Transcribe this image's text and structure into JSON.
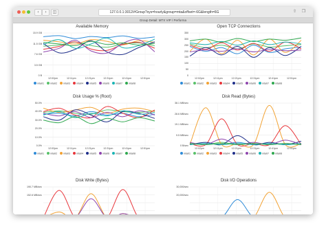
{
  "browser": {
    "url": "127.0.0.1:3012/#Group?sys=hourly&group=mta&offset=-6G&length=6G",
    "tab_title": "Group Detail: MTX VIP / Performa"
  },
  "icons": [
    "back-icon",
    "forward-icon",
    "sidebar-icon",
    "share-icon",
    "tabs-icon"
  ],
  "colors": {
    "mta01": "#2e8bd8",
    "mta02": "#59c16a",
    "mta03": "#f2a233",
    "mta04": "#e8363b",
    "mta05": "#1f2f8a",
    "mta06": "#8e44ad",
    "mta07": "#1ab4b4",
    "mta08": "#2fa84f"
  },
  "x_labels": [
    "12:02pm",
    "12:11pm",
    "12:21pm",
    "12:31pm",
    "12:41pm",
    "12:51pm"
  ],
  "legend_labels": [
    "mta01",
    "mta02",
    "mta03",
    "mta04",
    "mta05",
    "mta06",
    "mta07",
    "mta08"
  ],
  "panels": [
    {
      "id": "available-memory",
      "title": "Available Memory",
      "y_labels": [
        "15.9 GB",
        "11.5 GB",
        "7.6 GB",
        "3.5 GB",
        "0 B"
      ]
    },
    {
      "id": "open-tcp",
      "title": "Open TCP Connections",
      "y_labels": [
        "350",
        "300",
        "250",
        "200",
        "150",
        "100",
        "50",
        "0"
      ]
    },
    {
      "id": "disk-usage",
      "title": "Disk Usage % (Root)",
      "y_labels": [
        "50.0%",
        "40.0%",
        "30.0%",
        "20.0%",
        "10.0%",
        "0.0%"
      ]
    },
    {
      "id": "disk-read",
      "title": "Disk Read (Bytes)",
      "y_labels": [
        "38.1 MB/sec",
        "28.6 MB/sec",
        "19.1 MB/sec",
        "9.5 MB/sec",
        "0 B/sec"
      ]
    },
    {
      "id": "disk-write",
      "title": "Disk Write (Bytes)",
      "y_labels": [
        "190.7 MB/sec",
        "152.6 MB/sec"
      ]
    },
    {
      "id": "disk-io",
      "title": "Disk I/O Operations",
      "y_labels": [
        "30,000/sec",
        "20,000/sec"
      ]
    }
  ],
  "chart_data": [
    {
      "type": "line",
      "title": "Available Memory",
      "categories": [
        "12:02pm",
        "12:11pm",
        "12:21pm",
        "12:31pm",
        "12:41pm",
        "12:51pm"
      ],
      "ylim": [
        0,
        15.9
      ],
      "series": [
        {
          "name": "mta01",
          "values": [
            14.5,
            14.9,
            13.8,
            14.6,
            14.2,
            14.8,
            13.9,
            14.4
          ]
        },
        {
          "name": "mta02",
          "values": [
            11.0,
            11.4,
            12.5,
            11.2,
            10.6,
            11.8,
            12.2,
            11.1
          ]
        },
        {
          "name": "mta03",
          "values": [
            13.2,
            12.6,
            11.8,
            13.4,
            12.8,
            11.5,
            13.0,
            12.4
          ]
        },
        {
          "name": "mta04",
          "values": [
            9.8,
            10.9,
            12.6,
            9.9,
            9.4,
            11.6,
            12.4,
            10.2
          ]
        },
        {
          "name": "mta05",
          "values": [
            12.0,
            8.5,
            9.8,
            13.0,
            8.8,
            7.9,
            10.5,
            12.6
          ]
        },
        {
          "name": "mta06",
          "values": [
            8.8,
            10.2,
            13.2,
            9.2,
            8.4,
            12.1,
            13.4,
            8.9
          ]
        },
        {
          "name": "mta07",
          "values": [
            11.6,
            13.4,
            10.2,
            11.8,
            14.0,
            10.4,
            11.2,
            13.6
          ]
        },
        {
          "name": "mta08",
          "values": [
            12.4,
            11.8,
            11.2,
            12.8,
            11.6,
            12.2,
            11.4,
            12.0
          ]
        }
      ]
    },
    {
      "type": "line",
      "title": "Open TCP Connections",
      "categories": [
        "12:02pm",
        "12:11pm",
        "12:21pm",
        "12:31pm",
        "12:41pm",
        "12:51pm"
      ],
      "ylim": [
        0,
        350
      ],
      "series": [
        {
          "name": "mta01",
          "values": [
            240,
            200,
            230,
            180,
            250,
            190,
            220,
            235
          ]
        },
        {
          "name": "mta02",
          "values": [
            260,
            230,
            250,
            220,
            260,
            235,
            245,
            255
          ]
        },
        {
          "name": "mta03",
          "values": [
            200,
            300,
            180,
            290,
            170,
            300,
            190,
            290
          ]
        },
        {
          "name": "mta04",
          "values": [
            250,
            215,
            270,
            210,
            265,
            200,
            275,
            220
          ]
        },
        {
          "name": "mta05",
          "values": [
            160,
            230,
            170,
            240,
            150,
            230,
            165,
            240
          ]
        },
        {
          "name": "mta06",
          "values": [
            195,
            210,
            200,
            220,
            195,
            215,
            205,
            210
          ]
        },
        {
          "name": "mta07",
          "values": [
            270,
            255,
            280,
            250,
            285,
            255,
            275,
            260
          ]
        },
        {
          "name": "mta08",
          "values": [
            285,
            300,
            275,
            305,
            280,
            300,
            290,
            310
          ]
        }
      ]
    },
    {
      "type": "line",
      "title": "Disk Usage % (Root)",
      "categories": [
        "12:02pm",
        "12:11pm",
        "12:21pm",
        "12:31pm",
        "12:41pm",
        "12:51pm"
      ],
      "ylim": [
        0,
        50
      ],
      "series": [
        {
          "name": "mta01",
          "values": [
            37,
            38,
            35,
            40,
            36,
            38,
            34,
            37
          ]
        },
        {
          "name": "mta02",
          "values": [
            39,
            41,
            38,
            37,
            42,
            40,
            39,
            41
          ]
        },
        {
          "name": "mta03",
          "values": [
            44,
            39,
            42,
            45,
            38,
            43,
            44,
            40
          ]
        },
        {
          "name": "mta04",
          "values": [
            40,
            44,
            36,
            33,
            46,
            38,
            33,
            42
          ]
        },
        {
          "name": "mta05",
          "values": [
            34,
            30,
            42,
            36,
            28,
            40,
            38,
            32
          ]
        },
        {
          "name": "mta06",
          "values": [
            38,
            35,
            40,
            33,
            39,
            34,
            41,
            36
          ]
        },
        {
          "name": "mta07",
          "values": [
            36,
            40,
            33,
            38,
            35,
            41,
            37,
            39
          ]
        },
        {
          "name": "mta08",
          "values": [
            30,
            27,
            34,
            26,
            32,
            28,
            33,
            29
          ]
        }
      ]
    },
    {
      "type": "line",
      "title": "Disk Read (Bytes)",
      "categories": [
        "12:02pm",
        "12:11pm",
        "12:21pm",
        "12:31pm",
        "12:41pm",
        "12:51pm"
      ],
      "ylim": [
        0,
        38.1
      ],
      "series": [
        {
          "name": "mta01",
          "values": [
            1,
            2,
            1,
            3,
            1,
            2,
            1,
            2
          ]
        },
        {
          "name": "mta02",
          "values": [
            2,
            1,
            3,
            1,
            2,
            1,
            2,
            1
          ]
        },
        {
          "name": "mta03",
          "values": [
            1,
            34,
            1,
            2,
            1,
            36,
            1,
            2
          ]
        },
        {
          "name": "mta04",
          "values": [
            2,
            1,
            24,
            1,
            2,
            1,
            18,
            1
          ]
        },
        {
          "name": "mta05",
          "values": [
            1,
            3,
            1,
            9,
            1,
            3,
            1,
            4
          ]
        },
        {
          "name": "mta06",
          "values": [
            3,
            1,
            6,
            1,
            3,
            1,
            5,
            1
          ]
        },
        {
          "name": "mta07",
          "values": [
            1,
            2,
            1,
            2,
            1,
            2,
            1,
            2
          ]
        },
        {
          "name": "mta08",
          "values": [
            2,
            1,
            2,
            1,
            2,
            1,
            2,
            1
          ]
        }
      ]
    },
    {
      "type": "line",
      "title": "Disk Write (Bytes)",
      "categories": [
        "12:02pm",
        "12:11pm",
        "12:21pm",
        "12:31pm",
        "12:41pm",
        "12:51pm"
      ],
      "ylim": [
        0,
        190.7
      ],
      "series": [
        {
          "name": "mta01",
          "values": [
            5,
            10,
            5,
            8,
            5,
            10,
            5,
            8
          ]
        },
        {
          "name": "mta03",
          "values": [
            5,
            40,
            5,
            150,
            5,
            30,
            5,
            20
          ]
        },
        {
          "name": "mta04",
          "values": [
            5,
            170,
            5,
            20,
            5,
            175,
            5,
            10
          ]
        },
        {
          "name": "mta06",
          "values": [
            5,
            20,
            5,
            120,
            5,
            30,
            5,
            15
          ]
        }
      ]
    },
    {
      "type": "line",
      "title": "Disk I/O Operations",
      "categories": [
        "12:02pm",
        "12:11pm",
        "12:21pm",
        "12:31pm",
        "12:41pm",
        "12:51pm"
      ],
      "ylim": [
        0,
        30000
      ],
      "series": [
        {
          "name": "mta01",
          "values": [
            1000,
            1500,
            1000,
            18000,
            1000,
            2000,
            1000,
            1500
          ]
        },
        {
          "name": "mta03",
          "values": [
            1000,
            2000,
            1000,
            1500,
            1000,
            25000,
            1000,
            2000
          ]
        },
        {
          "name": "mta04",
          "values": [
            1000,
            1000,
            1000,
            2000,
            1000,
            1000,
            1000,
            1000
          ]
        }
      ]
    }
  ]
}
